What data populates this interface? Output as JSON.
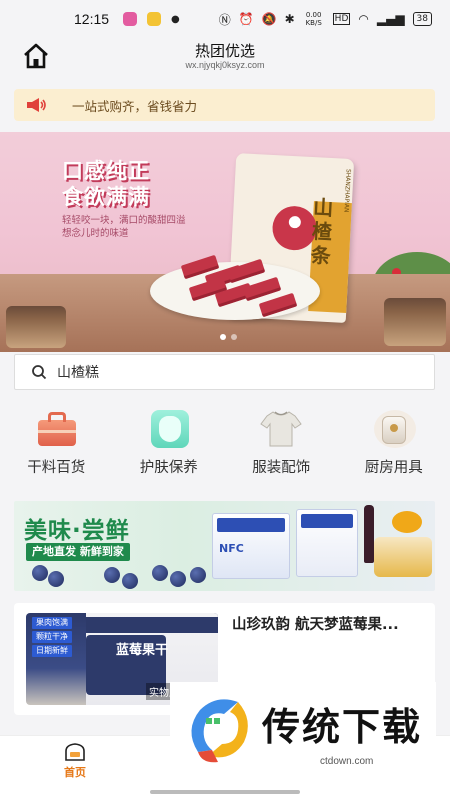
{
  "status_bar": {
    "time": "12:15",
    "battery": "38",
    "speed": "0.00 KB/S"
  },
  "header": {
    "title": "热团优选",
    "url": "wx.njyqkj0ksyz.com"
  },
  "notice": {
    "text": "一站式购齐，省钱省力"
  },
  "banner": {
    "headline_1": "口感纯正",
    "headline_2": "食欲满满",
    "subtext": "轻轻咬一块，满口的酸甜四溢 想念儿时的味道",
    "package_text": "山楂条",
    "package_brand": "SHANZHAPIAN"
  },
  "search": {
    "value": "山楂糕"
  },
  "categories": [
    {
      "label": "干料百货",
      "icon": "toolbox-icon"
    },
    {
      "label": "护肤保养",
      "icon": "face-mask-icon"
    },
    {
      "label": "服装配饰",
      "icon": "shirt-icon"
    },
    {
      "label": "厨房用具",
      "icon": "kettle-icon"
    }
  ],
  "promo": {
    "title": "美味·尝鲜",
    "subtitle": "产地直发 新鲜到家",
    "box_text": "NFC"
  },
  "product": {
    "name": "山珍玖韵 航天梦蓝莓果...",
    "tags": [
      "果肉饱满",
      "颗粒干净",
      "日期新鲜"
    ],
    "image_title": "蓝莓果干",
    "image_label": "实物产品"
  },
  "bottom_nav": {
    "home_label": "首页"
  },
  "watermark": {
    "text": "传统下载",
    "url": "ctdown.com"
  },
  "colors": {
    "accent": "#e67817",
    "notice_bg": "#fbeed0",
    "promo_green": "#1f8a4c"
  }
}
